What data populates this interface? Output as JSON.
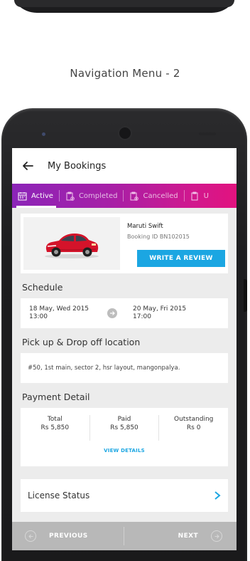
{
  "caption": "Navigation Menu - 2",
  "app_bar": {
    "title": "My Bookings",
    "back_icon": "arrow-left-icon"
  },
  "tabs": [
    {
      "label": "Active",
      "icon": "calendar-icon",
      "active": true
    },
    {
      "label": "Completed",
      "icon": "clipboard-check-icon",
      "active": false
    },
    {
      "label": "Cancelled",
      "icon": "clipboard-cancel-icon",
      "active": false
    },
    {
      "label": "U",
      "icon": "clipboard-icon",
      "active": false
    }
  ],
  "booking": {
    "car_name": "Maruti Swift",
    "booking_id": "Booking ID BN102015",
    "review_button": "WRITE A REVIEW"
  },
  "schedule": {
    "title": "Schedule",
    "start_date": "18 May, Wed 2015",
    "start_time": "13:00",
    "end_date": "20 May, Fri 2015",
    "end_time": "17:00"
  },
  "location": {
    "title": "Pick up & Drop off location",
    "address": "#50, 1st main, sector 2, hsr layout, mangonpalya."
  },
  "payment": {
    "title": "Payment Detail",
    "columns": [
      {
        "label": "Total",
        "value": "Rs 5,850"
      },
      {
        "label": "Paid",
        "value": "Rs 5,850"
      },
      {
        "label": "Outstanding",
        "value": "Rs 0"
      }
    ],
    "view_details": "VIEW DETAILS"
  },
  "license": {
    "label": "License Status"
  },
  "bottom_nav": {
    "previous": "PREVIOUS",
    "next": "NEXT"
  },
  "colors": {
    "tab_gradient_start": "#8b24b8",
    "tab_gradient_end": "#e2137f",
    "accent_blue": "#1ba6e2",
    "car_red": "#d4132a"
  }
}
